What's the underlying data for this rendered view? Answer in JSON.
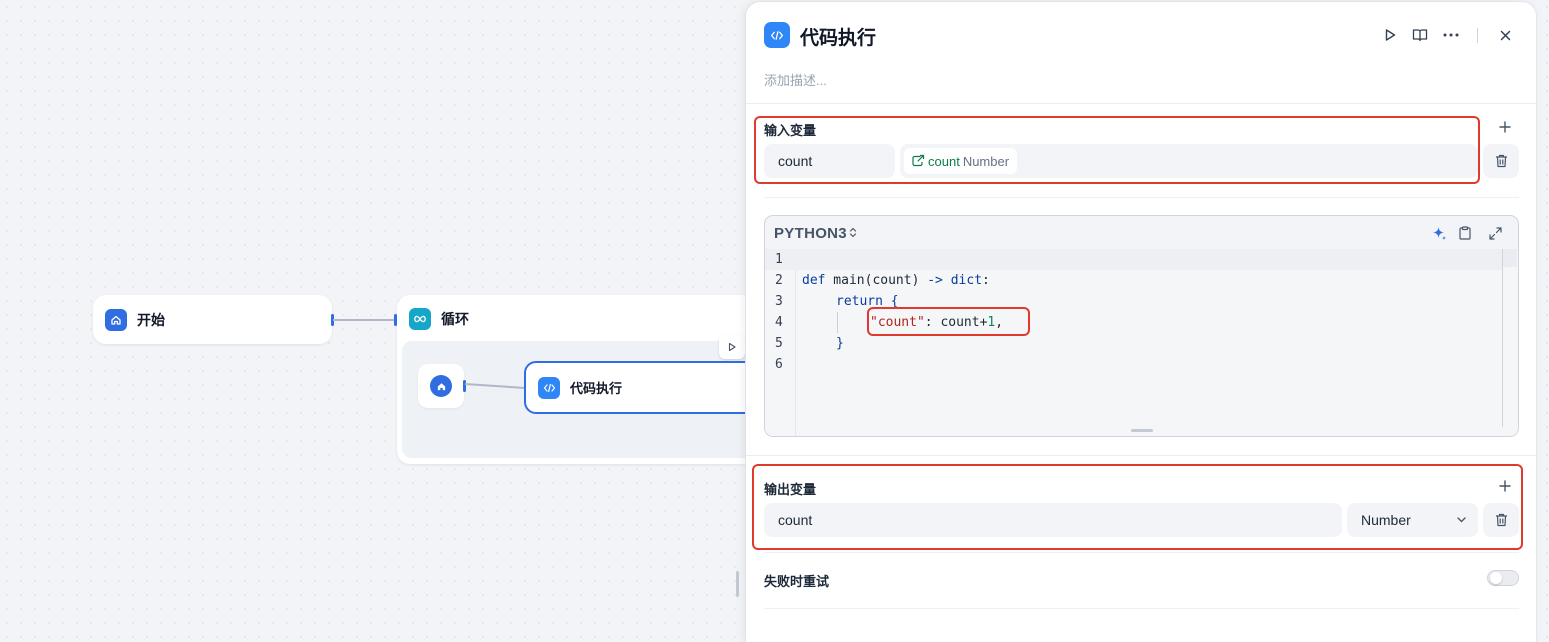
{
  "canvas": {
    "start_node": {
      "label": "开始",
      "icon": "home-icon",
      "color": "#2f6de1"
    },
    "loop_node": {
      "label": "循环",
      "icon": "infinity-icon",
      "color": "#15a6c8"
    },
    "inner_start_icon": "home-icon",
    "code_node": {
      "label": "代码执行",
      "icon": "code-icon",
      "color": "#2f86f6"
    }
  },
  "panel": {
    "title": "代码执行",
    "description_placeholder": "添加描述...",
    "header_icons": [
      "play-icon",
      "book-icon",
      "more-icon",
      "close-icon"
    ],
    "input_section": {
      "label": "输入变量",
      "variable_name": "count",
      "ref_name": "count",
      "ref_type": "Number"
    },
    "editor": {
      "language": "PYTHON3",
      "line_numbers": [
        "1",
        "2",
        "3",
        "4",
        "5",
        "6"
      ],
      "code": {
        "l2_def": "def",
        "l2_sig": " main(count) ",
        "l2_arrow": "->",
        "l2_type": " dict",
        "l2_colon": ":",
        "l3_return": "return",
        "l3_brace": " {",
        "l4_key": "\"count\"",
        "l4_expr": ": count+",
        "l4_num": "1",
        "l4_comma": ",",
        "l5_brace": "}"
      }
    },
    "output_section": {
      "label": "输出变量",
      "variable_name": "count",
      "type_value": "Number"
    },
    "retry_label": "失败时重试",
    "retry_enabled": false
  },
  "colors": {
    "accent": "#2f6de1",
    "highlight_box": "#e03a2e",
    "ref_tag_text": "#0f7a4e"
  }
}
